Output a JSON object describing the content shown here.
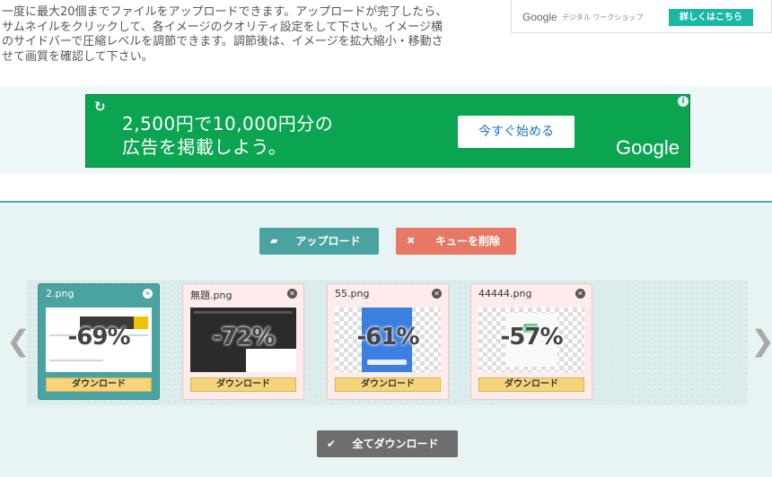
{
  "intro": {
    "lines": [
      "一度に最大20個までファイルをアップロードできます。アップロードが完了したら、",
      "サムネイルをクリックして、各イメージのクオリティ設定をして下さい。イメージ横",
      "のサイドバーで圧縮レベルを調節できます。調節後は、イメージを拡大縮小・移動さ",
      "せて画質を確認して下さい。"
    ]
  },
  "google_workshop_ad": {
    "brand": "Google",
    "subtitle": "デジタル ワークショップ",
    "cta": "詳しくはこちら"
  },
  "banner_ad": {
    "line1": "2,500円で10,000円分の",
    "line2": "広告を掲載しよう。",
    "cta": "今すぐ始める",
    "brand": "Google",
    "accent": "#0ba451"
  },
  "toolbar": {
    "upload_label": "アップロード",
    "clear_label": "キューを削除",
    "download_all_label": "全てダウンロード"
  },
  "files": [
    {
      "name": "2.png",
      "savings": "-69%",
      "download": "ダウンロード",
      "active": true
    },
    {
      "name": "無題.png",
      "savings": "-72%",
      "download": "ダウンロード",
      "active": false
    },
    {
      "name": "55.png",
      "savings": "-61%",
      "download": "ダウンロード",
      "active": false
    },
    {
      "name": "44444.png",
      "savings": "-57%",
      "download": "ダウンロード",
      "active": false
    }
  ],
  "icons": {
    "upload": "folder-open-icon",
    "clear": "close-icon",
    "download_all": "checkmark-icon",
    "prev": "chevron-left-icon",
    "next": "chevron-right-icon"
  }
}
